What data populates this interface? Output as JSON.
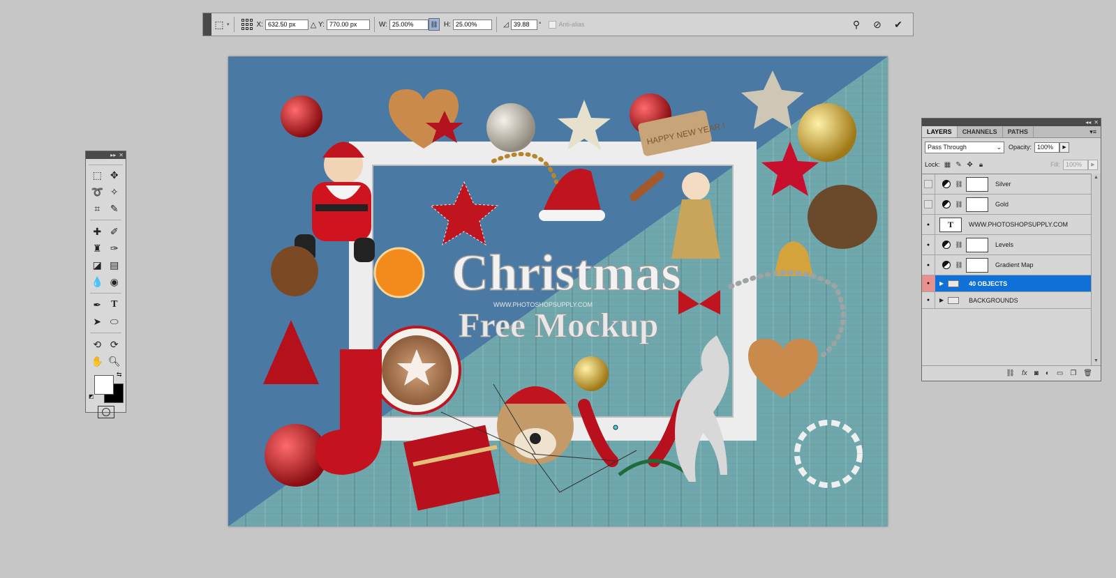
{
  "options_bar": {
    "x_label": "X:",
    "x_value": "632.50 px",
    "y_label": "Y:",
    "y_value": "770.00 px",
    "w_label": "W:",
    "w_value": "25.00%",
    "h_label": "H:",
    "h_value": "25.00%",
    "angle_value": "39.88",
    "angle_unit": "°",
    "antialias_label": "Anti-alias"
  },
  "canvas": {
    "title_line1": "Christmas",
    "title_line2": "Free Mockup",
    "site_credit": "WWW.PHOTOSHOPSUPPLY.COM",
    "tag_text": "HAPPY NEW YEAR !",
    "colors": {
      "blue_bg": "#4a7aa3",
      "wood_bg": "#6ea8ad",
      "red": "#b3121e",
      "frame": "#e8e8e8"
    }
  },
  "layers_panel": {
    "tabs": [
      {
        "label": "LAYERS",
        "active": true
      },
      {
        "label": "CHANNELS",
        "active": false
      },
      {
        "label": "PATHS",
        "active": false
      }
    ],
    "blend_mode": "Pass Through",
    "opacity_label": "Opacity:",
    "opacity_value": "100%",
    "lock_label": "Lock:",
    "fill_label": "Fill:",
    "fill_value": "100%",
    "layers": [
      {
        "name": "Silver",
        "kind": "adjustment",
        "visible": false
      },
      {
        "name": "Gold",
        "kind": "adjustment",
        "visible": false
      },
      {
        "name": "WWW.PHOTOSHOPSUPPLY.COM",
        "kind": "text",
        "visible": true,
        "thumb": "T"
      },
      {
        "name": "Levels",
        "kind": "adjustment",
        "visible": true
      },
      {
        "name": "Gradient Map",
        "kind": "adjustment",
        "visible": true
      },
      {
        "name": "40 OBJECTS",
        "kind": "group",
        "visible": true,
        "selected": true
      },
      {
        "name": "BACKGROUNDS",
        "kind": "group",
        "visible": true
      }
    ],
    "footer_icons": [
      "link-icon",
      "fx-icon",
      "mask-icon",
      "adjustment-icon",
      "group-icon",
      "new-layer-icon",
      "trash-icon"
    ]
  }
}
